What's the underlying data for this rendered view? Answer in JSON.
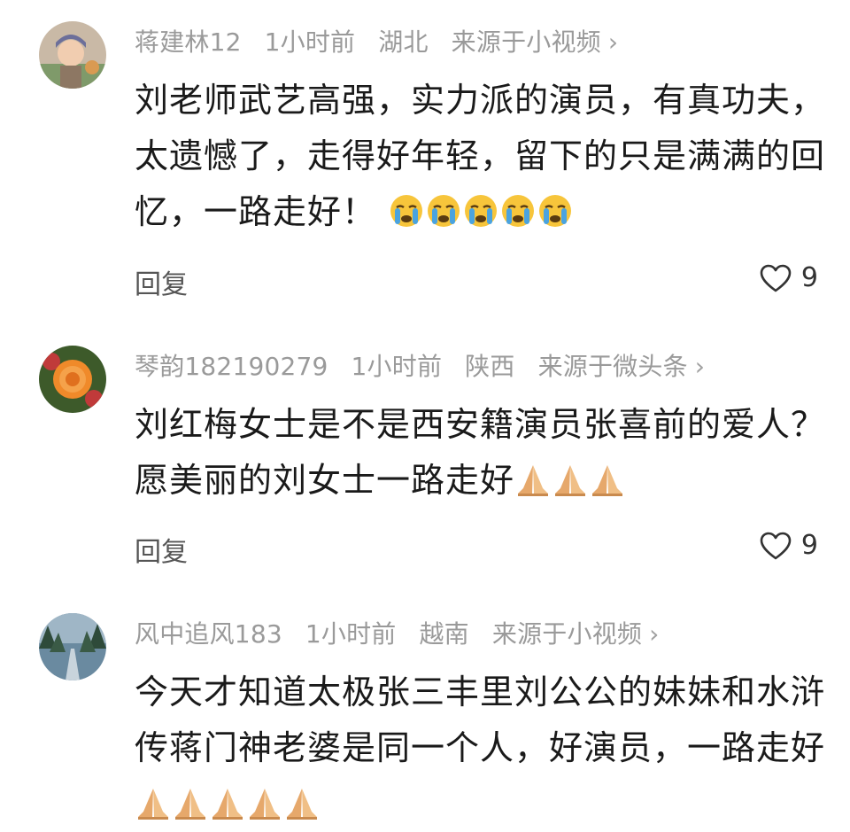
{
  "comments": [
    {
      "username": "蒋建林12",
      "time": "1小时前",
      "location": "湖北",
      "source": "来源于小视频",
      "text": "刘老师武艺高强，实力派的演员，有真功夫，太遗憾了，走得好年轻，留下的只是满满的回忆，一路走好！",
      "emoji": "crying-face-icon",
      "emoji_count": 5,
      "reply_label": "回复",
      "likes": "9"
    },
    {
      "username": "琴韵182190279",
      "time": "1小时前",
      "location": "陕西",
      "source": "来源于微头条",
      "text": "刘红梅女士是不是西安籍演员张喜前的爱人？愿美丽的刘女士一路走好",
      "emoji": "folded-hands-icon",
      "emoji_count": 3,
      "reply_label": "回复",
      "likes": "9"
    },
    {
      "username": "风中追风183",
      "time": "1小时前",
      "location": "越南",
      "source": "来源于小视频",
      "text": "今天才知道太极张三丰里刘公公的妹妹和水浒传蒋门神老婆是同一个人，好演员，一路走好",
      "emoji": "folded-hands-icon",
      "emoji_count": 5
    }
  ],
  "chevron": "›",
  "colors": {
    "meta": "#9a9a9a",
    "text": "#1a1a1a",
    "reply": "#555555",
    "emoji_yellow": "#f7c53b",
    "emoji_tears": "#4aa3df",
    "hands": "#e6a86b"
  }
}
